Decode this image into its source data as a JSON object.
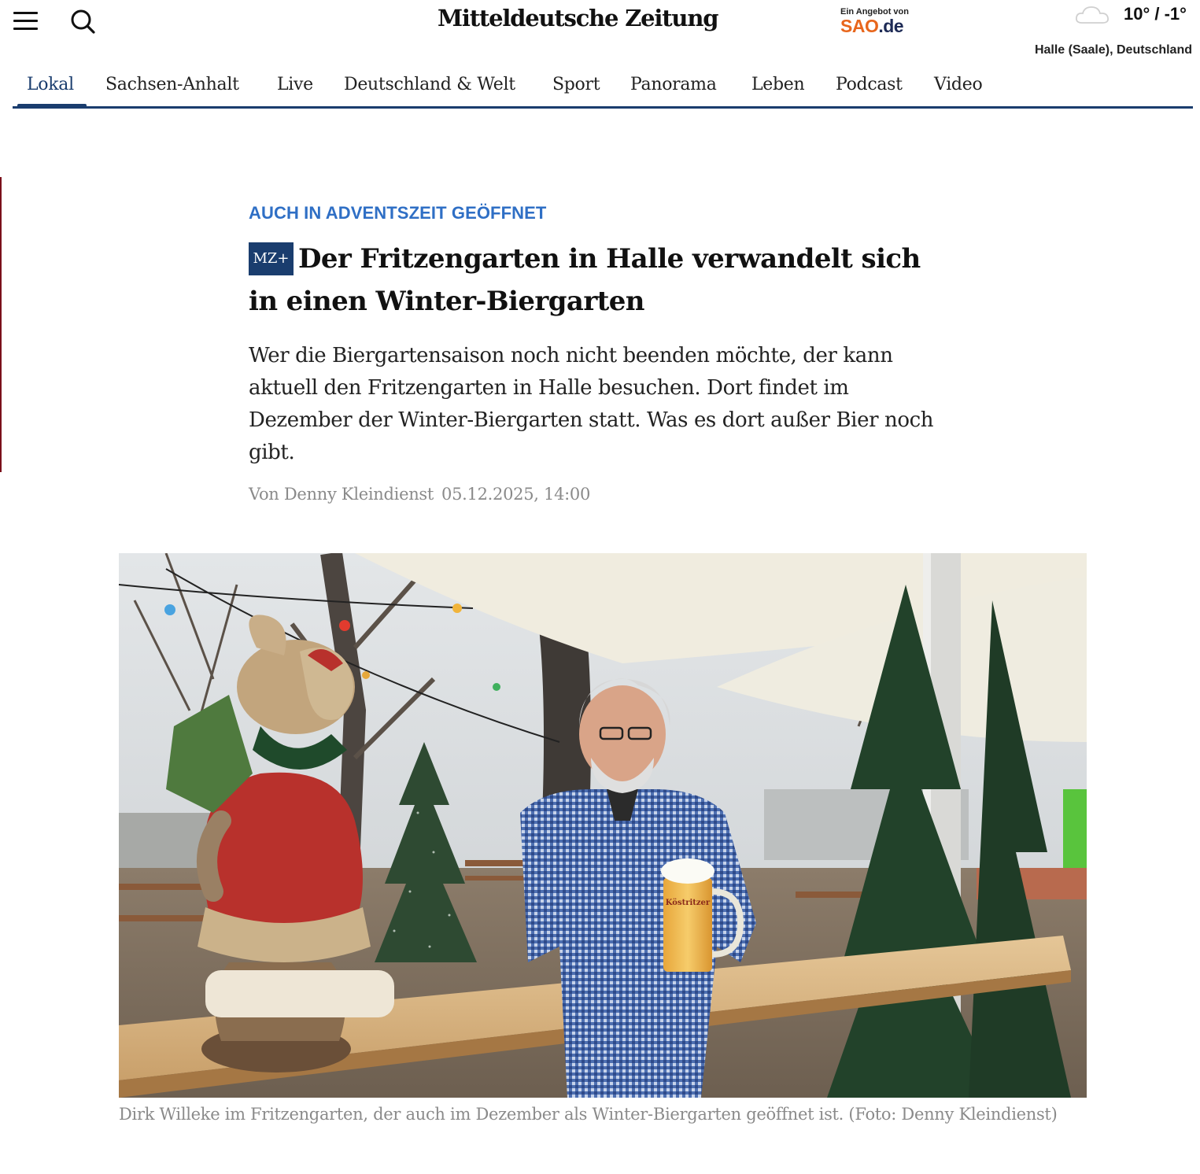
{
  "header": {
    "logo": "Mitteldeutsche Zeitung",
    "sao_small": "Ein Angebot von",
    "sao_brand": "SAO",
    "sao_tld": ".de",
    "temperature": "10° / -1°",
    "location": "Halle (Saale), Deutschland",
    "weather_icon": "cloud-icon"
  },
  "nav": {
    "items": [
      "Lokal",
      "Sachsen-Anhalt",
      "Live",
      "Deutschland & Welt",
      "Sport",
      "Panorama",
      "Leben",
      "Podcast",
      "Video"
    ],
    "active": "Lokal"
  },
  "article": {
    "kicker": "AUCH IN ADVENTSZEIT GEÖFFNET",
    "badge": "MZ+",
    "headline": "Der Fritzengarten in Halle verwandelt sich in einen Winter-Biergarten",
    "teaser": "Wer die Biergartensaison noch nicht beenden möchte, der kann aktuell den Fritzengarten in Halle besuchen. Dort findet im Dezember der Winter-Biergarten statt. Was es dort außer Bier noch gibt.",
    "author": "Von Denny Kleindienst",
    "date": "05.12.2025, 14:00",
    "photo": {
      "mug_text": "Köstritzer",
      "caption": "Dirk Willeke im Fritzengarten, der auch im Dezember als Winter-Biergarten geöffnet ist. (Foto: Denny Kleindienst)"
    }
  },
  "colors": {
    "brand_blue": "#1a3d6e",
    "kicker_blue": "#2f6fc5",
    "sao_orange": "#e8661c",
    "meta_gray": "#8a8a8a"
  }
}
